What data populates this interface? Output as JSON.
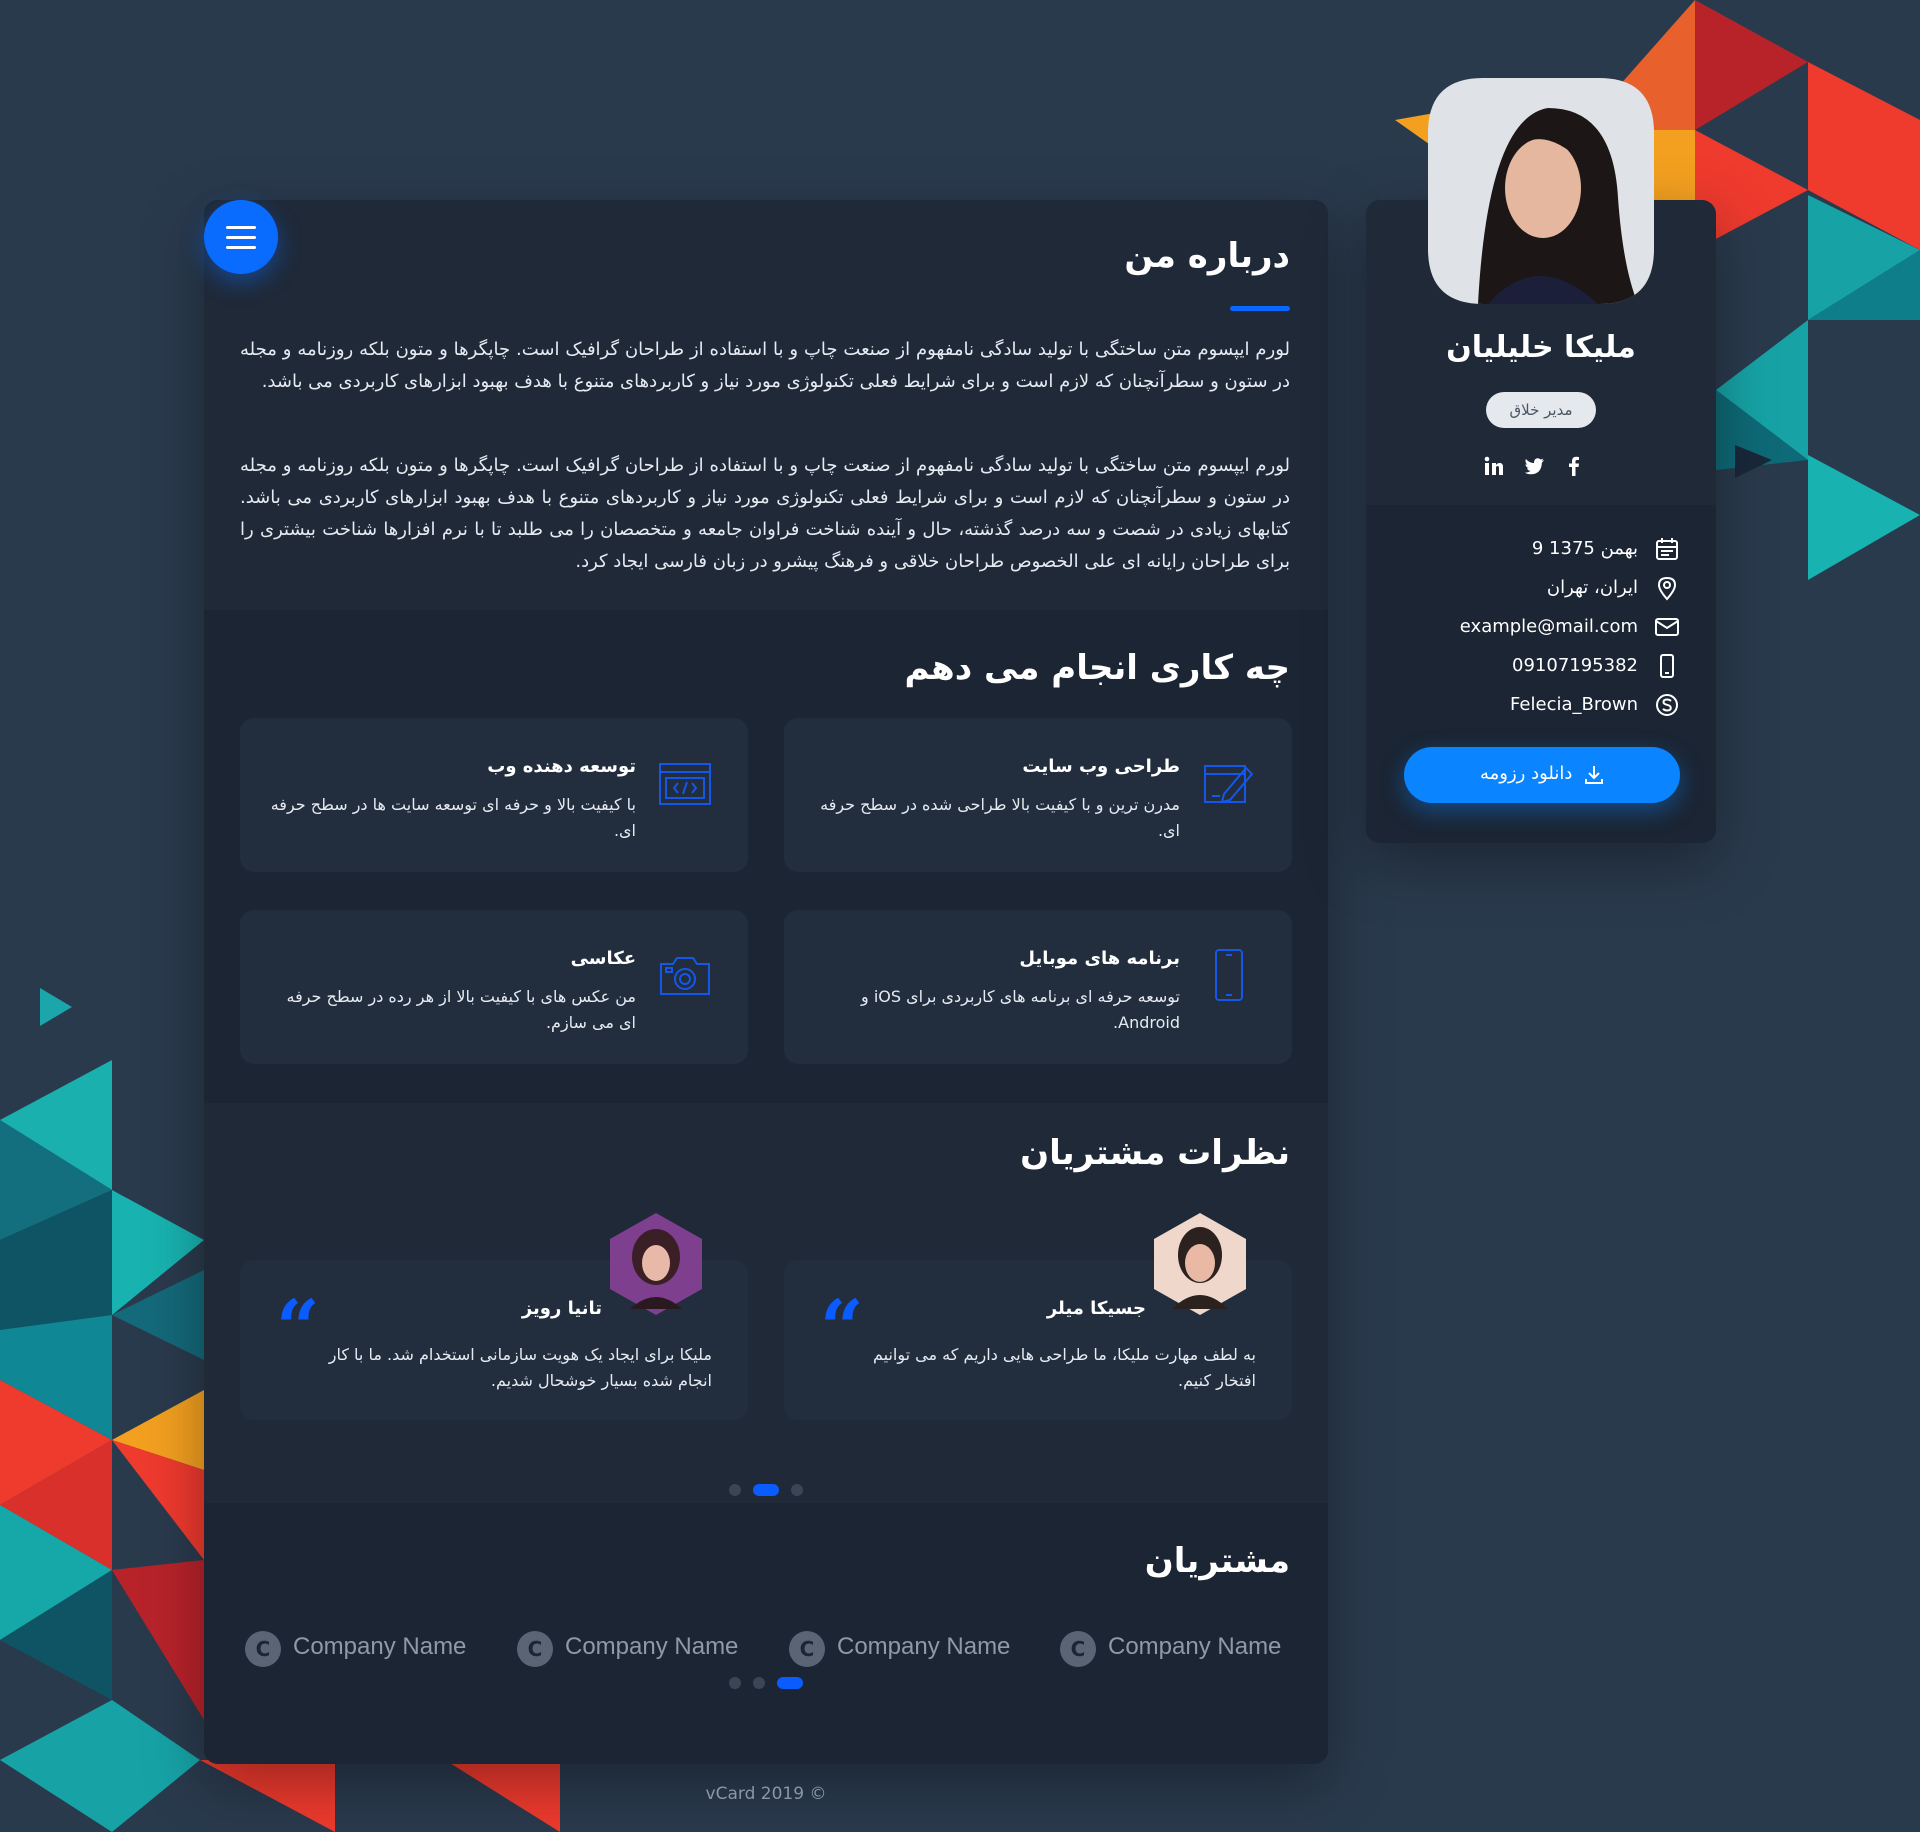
{
  "about": {
    "title": "درباره من",
    "paragraph_1": "لورم ایپسوم متن ساختگی با تولید سادگی نامفهوم از صنعت چاپ و با استفاده از طراحان گرافیک است. چاپگرها و متون بلکه روزنامه و مجله در ستون و سطرآنچنان که لازم است و برای شرایط فعلی تکنولوژی مورد نیاز و کاربردهای متنوع با هدف بهبود ابزارهای کاربردی می باشد.",
    "paragraph_2": "لورم ایپسوم متن ساختگی با تولید سادگی نامفهوم از صنعت چاپ و با استفاده از طراحان گرافیک است. چاپگرها و متون بلکه روزنامه و مجله در ستون و سطرآنچنان که لازم است و برای شرایط فعلی تکنولوژی مورد نیاز و کاربردهای متنوع با هدف بهبود ابزارهای کاربردی می باشد. کتابهای زیادی در شصت و سه درصد گذشته، حال و آینده شناخت فراوان جامعه و متخصصان را می طلبد تا با نرم افزارها شناخت بیشتری را برای طراحان رایانه ای علی الخصوص طراحان خلاقی و فرهنگ پیشرو در زبان فارسی ایجاد کرد."
  },
  "services": {
    "title": "چه کاری انجام می دهم",
    "items": [
      {
        "title": "طراحی وب سایت",
        "desc": "مدرن ترین و با کیفیت بالا طراحی شده در سطح حرفه ای.",
        "icon": "web-design-icon"
      },
      {
        "title": "توسعه دهنده وب",
        "desc": "با کیفیت بالا و حرفه ای توسعه سایت ها در سطح حرفه ای.",
        "icon": "code-window-icon"
      },
      {
        "title": "برنامه های موبایل",
        "desc": "توسعه حرفه ای برنامه های کاربردی برای iOS و Android.",
        "icon": "mobile-phone-icon"
      },
      {
        "title": "عکاسی",
        "desc": "من عکس های با کیفیت بالا از هر رده در سطح حرفه ای می سازم.",
        "icon": "camera-icon"
      }
    ]
  },
  "testimonials": {
    "title": "نظرات مشتریان",
    "items": [
      {
        "name": "جسیکا میلر",
        "text": "به لطف مهارت ملیکا، ما طراحی هایی داریم که می توانیم افتخار کنیم."
      },
      {
        "name": "تانیا رویز",
        "text": "ملیکا برای ایجاد یک هویت سازمانی استخدام شد. ما با کار انجام شده بسیار خوشحال شدیم."
      }
    ],
    "active_page": 2,
    "page_count": 3
  },
  "clients": {
    "title": "مشتریان",
    "logo_letter": "C",
    "items": [
      "Company Name",
      "Company Name",
      "Company Name",
      "Company Name"
    ],
    "active_page": 3,
    "page_count": 3
  },
  "footer": {
    "text": "vCard 2019 ©"
  },
  "profile": {
    "name": "ملیکا خلیلیان",
    "title": "مدیر خلاق",
    "social": [
      "linkedin-icon",
      "twitter-icon",
      "facebook-icon"
    ],
    "birthday": "9 بهمن 1375",
    "location": "ایران، تهران",
    "email": "example@mail.com",
    "phone": "09107195382",
    "skype": "Felecia_Brown",
    "download_label": "دانلود رزومه"
  },
  "colors": {
    "background": "#2a3a4d",
    "card": "#1f2937",
    "accent": "#0a84ff",
    "accent_dark": "#0a5cff"
  }
}
